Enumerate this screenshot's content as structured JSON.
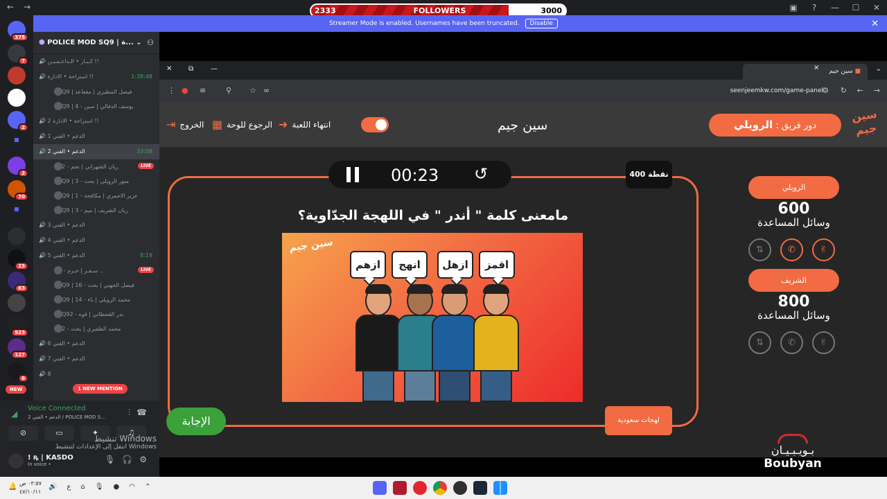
{
  "obs": {
    "followers_label": "FOLLOWERS",
    "followers_current": "2333",
    "followers_goal": "3000",
    "followers_progress": 0.7777
  },
  "discord": {
    "streamer_notice": "Streamer Mode is enabled. Usernames have been truncated.",
    "disable_label": "Disable",
    "server_name": "POLICE MOD SQ9 | ة...",
    "guild_badges": [
      "375",
      "7",
      "2",
      "2",
      "70",
      "23",
      "63",
      "523",
      "127",
      "6"
    ],
    "new_label": "NEW",
    "channels": [
      {
        "name": "كـبـار • الـداعـمـيـن !!",
        "sub": false
      },
      {
        "name": "استراحة • الادارة !!",
        "sub": false,
        "time": "1:38:48"
      },
      {
        "name": "SQ9 | فيصل المطيري | مقعاعد",
        "sub": true
      },
      {
        "name": "SQ9 | 4 - يوسف الدفالي | سين",
        "sub": true
      },
      {
        "name": "استراحة • الادارة 2 !!",
        "sub": false
      },
      {
        "name": "الدعم • الفني 1",
        "sub": false
      },
      {
        "name": "الدعم • الفني 2",
        "sub": false,
        "time": "33:08",
        "active": true
      },
      {
        "name": "62 - ريان الشهراني | نجم",
        "sub": true,
        "live": true
      },
      {
        "name": "SQ9 | 3 - منور الرويلي | بحث",
        "sub": true
      },
      {
        "name": "SQ9 | 1 - عزيز الاحمري | مكافحة",
        "sub": true
      },
      {
        "name": "SQ9 | 3 - ريان الشريف | ميم",
        "sub": true
      },
      {
        "name": "الدعم • الفني 3",
        "sub": false
      },
      {
        "name": "الدعم • الفني 4",
        "sub": false
      },
      {
        "name": "الدعم • الفني 5",
        "sub": false,
        "time": "8:19"
      },
      {
        "name": "1 - سـفـر | حـزم ...",
        "sub": true,
        "live": true
      },
      {
        "name": "SQ9 | 16 - فيصل الجهني | بحث",
        "sub": true
      },
      {
        "name": "SQ9 | 14 - محمد الرويلي | باء",
        "sub": true
      },
      {
        "name": "SQ92 - بدر القحطاني | قوه",
        "sub": true
      },
      {
        "name": "12 - محمد الظفيري | بحث",
        "sub": true
      },
      {
        "name": "الدعم • الفني 6",
        "sub": false
      },
      {
        "name": "الدعم • الفني 7",
        "sub": false
      },
      {
        "name": "8",
        "sub": false
      }
    ],
    "live_label": "LIVE",
    "new_mention": "1 NEW MENTION",
    "voice_connected": "Voice Connected",
    "voice_server": "الدعم • الفني 2 / POLICE MOD S...",
    "user_name": "! ꝶ | KASDO",
    "user_status": "In voice •",
    "windows_activate": "تنشيط Windows",
    "windows_activate_sub": "انتقل إلى الإعدادات لتنشيط Windows"
  },
  "browser": {
    "tab_title": "سين جيم",
    "url": "seenjeemkw.com/game-panel"
  },
  "game": {
    "title": "سين جيم",
    "turn_prefix": "دور فريق :",
    "turn_team": "الرويلي",
    "logo_text": "سين جيم",
    "exit_label": "الخروج",
    "back_label": "الرجوع للوحة",
    "end_label": "انتهاء اللعبة",
    "timer": "00:23",
    "points": "400 نقطة",
    "question": "مامعنى كلمة \" أندر \" في اللهجة الجدّاوية؟",
    "bubbles": [
      "ازهم",
      "انهج",
      "ازهل",
      "اقمز"
    ],
    "answer_label": "الإجابة",
    "category": "لهجات سعودية",
    "teams": [
      {
        "name": "الرويلي",
        "score": "600",
        "label": "وسائل المساعدة"
      },
      {
        "name": "الشريف",
        "score": "800",
        "label": "وسائل المساعدة"
      }
    ],
    "sponsor_ar": "بـويـبـيـان",
    "sponsor_en": "Boubyan"
  },
  "taskbar": {
    "time": "٠٣:٥٧ ص",
    "date": "٤٧/١٠/١١",
    "lang": "ع"
  },
  "colors": {
    "accent": "#f26b43",
    "discord_blurple": "#5865f2",
    "live_red": "#ed4245",
    "green": "#3ba13b"
  }
}
